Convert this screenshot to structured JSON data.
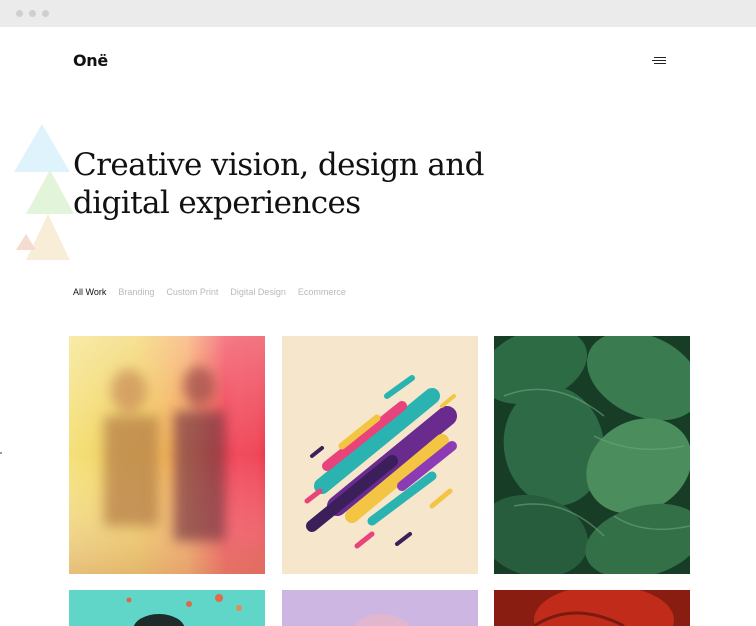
{
  "brand": {
    "logo_text": "Onë"
  },
  "nav": {
    "menu_icon": "hamburger-menu-icon"
  },
  "hero": {
    "title": "Creative vision, design and digital experiences"
  },
  "filters": {
    "items": [
      {
        "label": "All Work",
        "active": true
      },
      {
        "label": "Branding",
        "active": false
      },
      {
        "label": "Custom Print",
        "active": false
      },
      {
        "label": "Digital Design",
        "active": false
      },
      {
        "label": "Ecommerce",
        "active": false
      }
    ]
  },
  "portfolio": {
    "tiles": [
      {
        "subject": "blurred-people-colorful",
        "accent": "#f0364a"
      },
      {
        "subject": "abstract-colorful-shapes",
        "accent": "#f6e6cc"
      },
      {
        "subject": "tropical-leaves",
        "accent": "#1c4b2f"
      },
      {
        "subject": "teal-background-photo",
        "accent": "#5fd6c8"
      },
      {
        "subject": "lavender-background-photo",
        "accent": "#cdb6e2"
      },
      {
        "subject": "red-leaf-photo",
        "accent": "#c02b1a"
      }
    ]
  },
  "colors": {
    "text": "#111111",
    "muted": "#b9b9b9",
    "browser_bar": "#ebebeb"
  }
}
